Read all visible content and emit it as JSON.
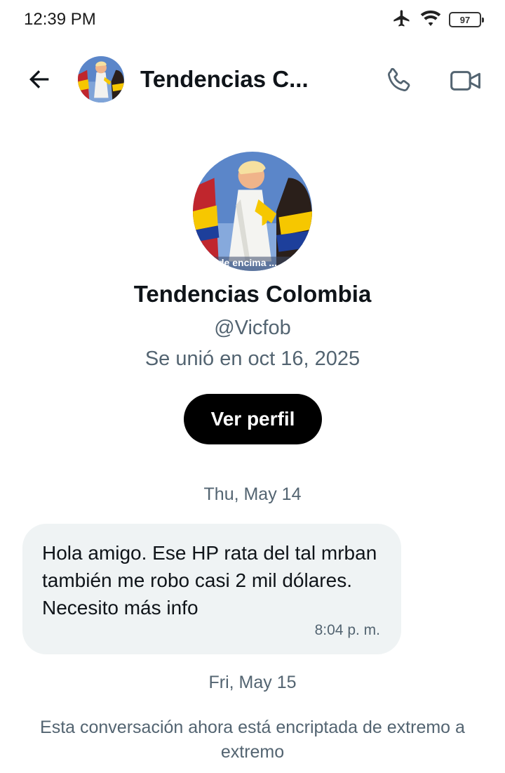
{
  "status_bar": {
    "time": "12:39 PM",
    "battery": "97",
    "icons": [
      "airplane-icon",
      "wifi-icon",
      "battery-icon"
    ]
  },
  "header": {
    "title": "Tendencias C...",
    "back_icon": "arrow-left-icon",
    "call_icon": "phone-icon",
    "video_icon": "video-camera-icon"
  },
  "profile": {
    "name": "Tendencias Colombia",
    "handle": "@Vicfob",
    "joined": "Se unió en oct 16, 2025",
    "view_button_label": "Ver perfil",
    "avatar_caption": "de encima ..."
  },
  "conversation": {
    "date_1": "Thu, May 14",
    "messages": [
      {
        "text": "Hola amigo. Ese HP rata del tal mrban también me robo casi 2 mil dólares. Necesito más info",
        "time": "8:04 p. m."
      }
    ],
    "date_2": "Fri, May 15",
    "encryption_note": "Esta conversación ahora está encriptada de extremo a extremo"
  },
  "colors": {
    "primary_text": "#0f1419",
    "secondary_text": "#536471",
    "bubble_bg": "#eff3f4",
    "button_bg": "#000000"
  }
}
